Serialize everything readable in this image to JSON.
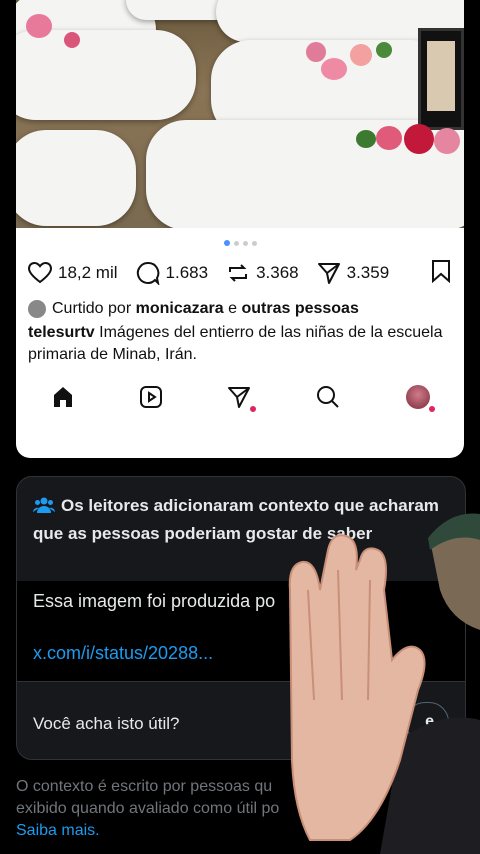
{
  "post": {
    "actions": {
      "likes": "18,2 mil",
      "comments": "1.683",
      "reposts": "3.368",
      "shares": "3.359"
    },
    "liked_by": {
      "prefix": "Curtido por",
      "user": "monicazara",
      "joiner": "e",
      "others": "outras pessoas"
    },
    "caption": {
      "author": "telesurtv",
      "text": "Imágenes del entierro de las niñas de la escuela primaria de Minab, Irán."
    },
    "carousel_dots": 4,
    "tabbar": [
      "home-icon",
      "reels-icon",
      "send-icon",
      "search-icon",
      "profile-avatar"
    ]
  },
  "note": {
    "header": "Os leitores adicionaram contexto que acharam que as pessoas poderiam gostar de saber",
    "body_text": "Essa imagem foi produzida po",
    "link": "x.com/i/status/20288...",
    "useful_question": "Você acha isto útil?",
    "rate_label": "e"
  },
  "footer": {
    "text": "O contexto é escrito por pessoas qu exibido quando avaliado como útil po",
    "more": "Saiba mais."
  },
  "colors": {
    "accent": "#1d9bf0",
    "notification": "#e0245e"
  }
}
